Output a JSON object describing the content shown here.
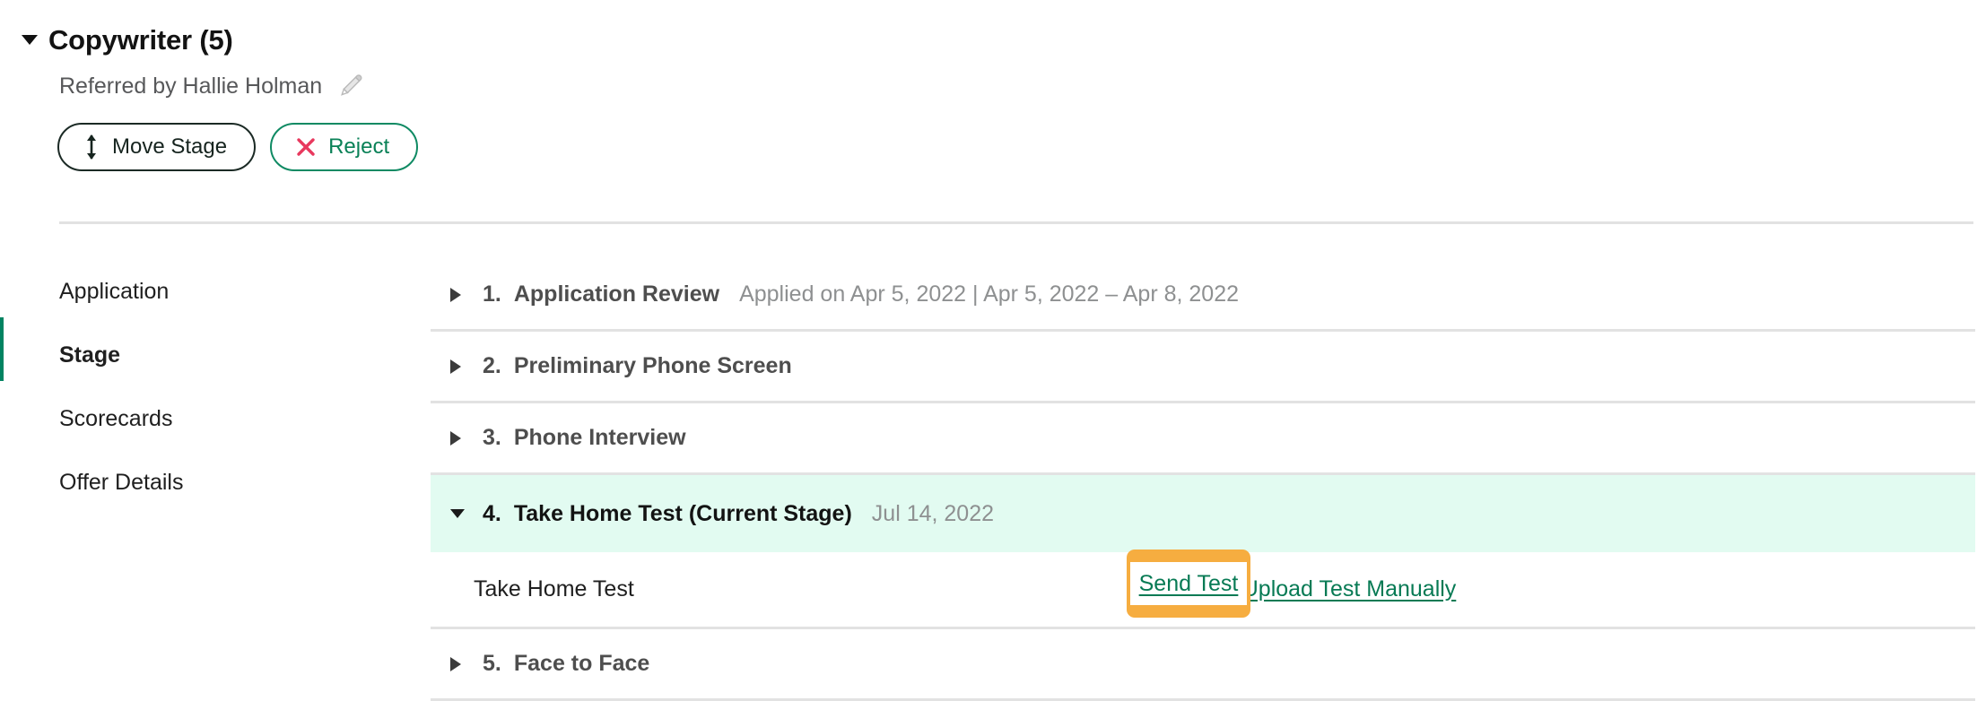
{
  "header": {
    "title": "Copywriter (5)",
    "referred_by": "Referred by Hallie Holman",
    "edit_icon": "pencil-icon",
    "caret_icon": "caret-down-icon",
    "buttons": {
      "move_stage": "Move Stage",
      "move_stage_icon": "up-down-arrow-icon",
      "reject": "Reject",
      "reject_icon": "x-close-icon"
    }
  },
  "left_nav": {
    "items": [
      {
        "label": "Application",
        "active": false
      },
      {
        "label": "Stage",
        "active": true
      },
      {
        "label": "Scorecards",
        "active": false
      },
      {
        "label": "Offer Details",
        "active": false
      }
    ]
  },
  "stages": [
    {
      "number": "1.",
      "name": "Application Review",
      "meta": "Applied on Apr 5, 2022 | Apr 5, 2022 – Apr 8, 2022",
      "expanded": false,
      "current": false
    },
    {
      "number": "2.",
      "name": "Preliminary Phone Screen",
      "meta": "",
      "expanded": false,
      "current": false
    },
    {
      "number": "3.",
      "name": "Phone Interview",
      "meta": "",
      "expanded": false,
      "current": false
    },
    {
      "number": "4.",
      "name": "Take Home Test (Current Stage)",
      "meta": "Jul 14, 2022",
      "expanded": true,
      "current": true
    },
    {
      "number": "5.",
      "name": "Face to Face",
      "meta": "",
      "expanded": false,
      "current": false
    }
  ],
  "take_home_test_row": {
    "label": "Take Home Test",
    "send_test_link": "Send Test",
    "upload_test_link": "Upload Test Manually"
  },
  "colors": {
    "accent_green": "#018361",
    "link_green": "#077a54",
    "current_stage_bg": "#e2fbf1",
    "highlight_orange": "#f6ad40",
    "reject_red": "#e8395e",
    "divider": "#e2e2e2"
  }
}
